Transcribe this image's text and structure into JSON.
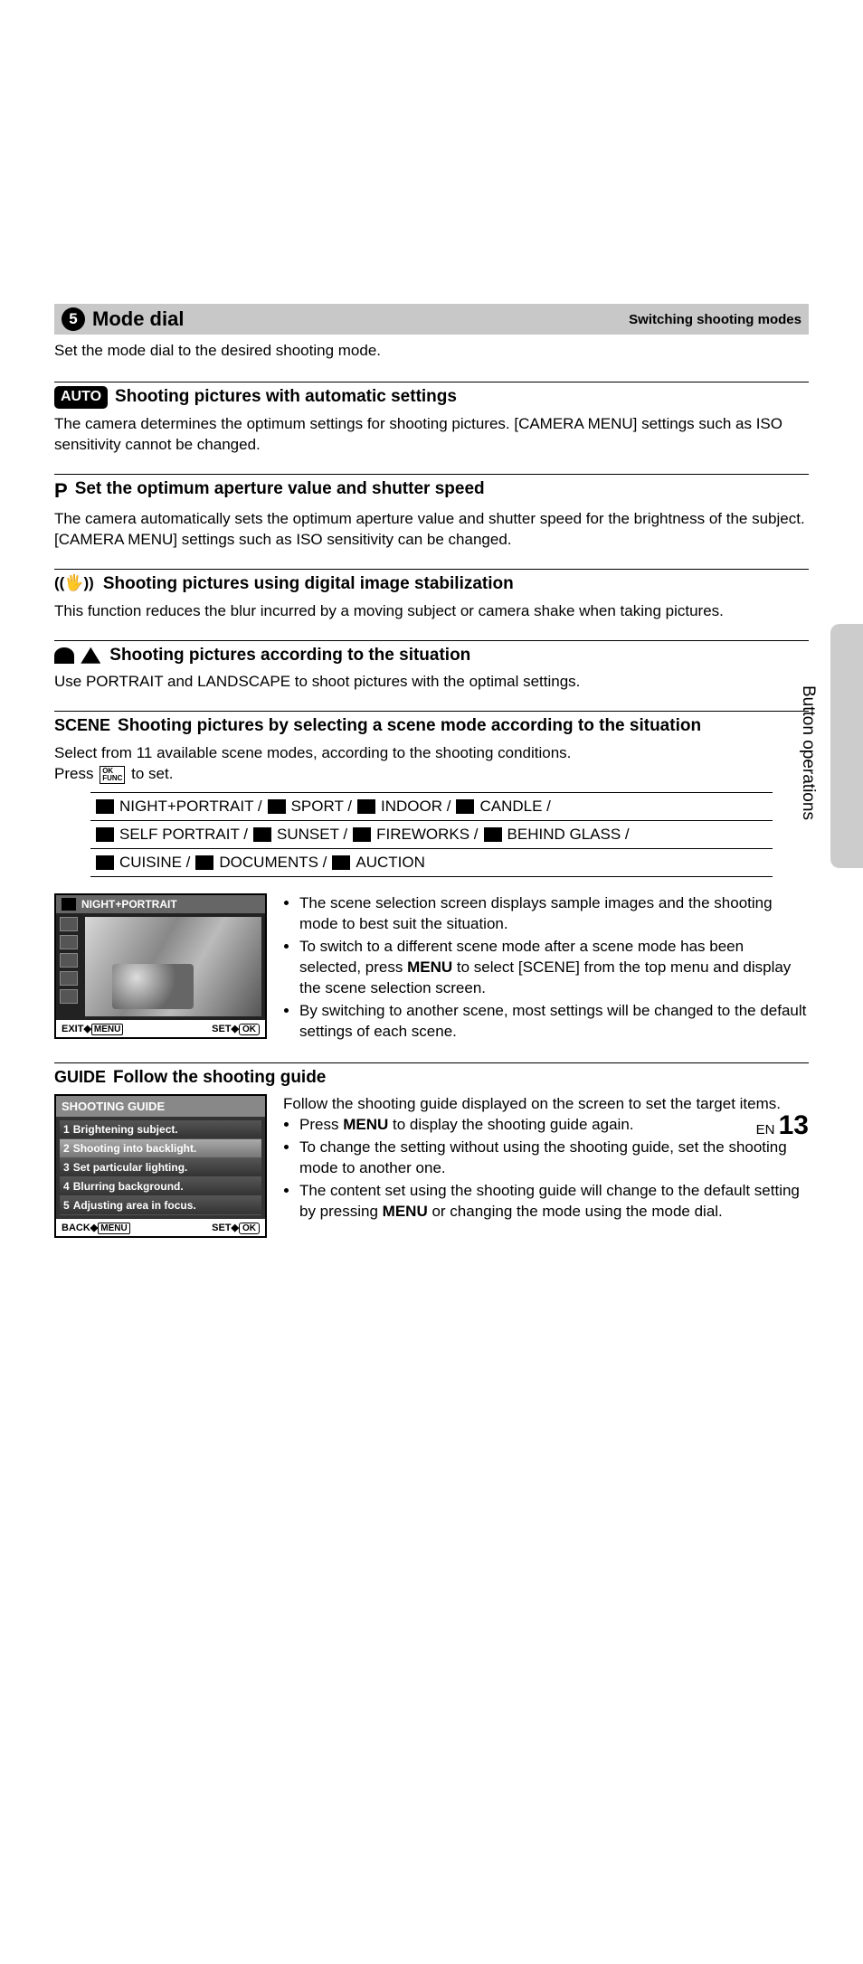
{
  "header": {
    "number": "5",
    "title": "Mode dial",
    "subtitle": "Switching shooting modes"
  },
  "intro": "Set the mode dial to the desired shooting mode.",
  "sections": {
    "auto": {
      "badge": "AUTO",
      "heading": "Shooting pictures with automatic settings",
      "body": "The camera determines the optimum settings for shooting pictures. [CAMERA MENU] settings such as ISO sensitivity cannot be changed."
    },
    "p": {
      "badge": "P",
      "heading": "Set the optimum aperture value and shutter speed",
      "body": "The camera automatically sets the optimum aperture value and shutter speed for the brightness of the subject. [CAMERA MENU] settings such as ISO sensitivity can be changed."
    },
    "stab": {
      "heading": "Shooting pictures using digital image stabilization",
      "body": "This function reduces the blur incurred by a moving subject or camera shake when taking pictures."
    },
    "pl": {
      "heading": "Shooting pictures according to the situation",
      "body": "Use PORTRAIT and LANDSCAPE to shoot pictures with the optimal settings."
    },
    "scene": {
      "badge": "SCENE",
      "heading": "Shooting pictures by selecting a scene mode according to the situation",
      "body1": "Select from 11 available scene modes, according to the shooting conditions.",
      "body2_pre": "Press ",
      "body2_post": " to set.",
      "ok_top": "OK",
      "ok_bot": "FUNC",
      "row1": [
        "NIGHT+PORTRAIT /",
        "SPORT /",
        "INDOOR /",
        "CANDLE /"
      ],
      "row2": [
        "SELF PORTRAIT /",
        "SUNSET /",
        "FIREWORKS /",
        "BEHIND GLASS /"
      ],
      "row3": [
        "CUISINE /",
        "DOCUMENTS /",
        "AUCTION"
      ],
      "lcd_title": "NIGHT+PORTRAIT",
      "lcd_exit": "EXIT",
      "lcd_set": "SET",
      "lcd_menu": "MENU",
      "lcd_ok": "OK",
      "bullets": [
        "The scene selection screen displays sample images and the shooting mode to best suit the situation.",
        "To switch to a different scene mode after a scene mode has been selected, press <b>MENU</b> to select [SCENE] from the top menu and display the scene selection screen.",
        "By switching to another scene, most settings will be changed to the default settings of each scene."
      ]
    },
    "guide": {
      "badge": "GUIDE",
      "heading": "Follow the shooting guide",
      "panel_title": "SHOOTING GUIDE",
      "items": [
        {
          "num": "1",
          "label": "Brightening subject."
        },
        {
          "num": "2",
          "label": "Shooting into backlight."
        },
        {
          "num": "3",
          "label": "Set particular lighting."
        },
        {
          "num": "4",
          "label": "Blurring background."
        },
        {
          "num": "5",
          "label": "Adjusting area in focus."
        }
      ],
      "back": "BACK",
      "set": "SET",
      "menu": "MENU",
      "ok": "OK",
      "body_intro": "Follow the shooting guide displayed on the screen to set the target items.",
      "bullets": [
        "Press <b>MENU</b> to display the shooting guide again.",
        "To change the setting without using the shooting guide, set the shooting mode to another one.",
        "The content set using the shooting guide will change to the default setting by pressing <b>MENU</b> or changing the mode using the mode dial."
      ]
    }
  },
  "side_label": "Button operations",
  "page_lang": "EN",
  "page_num": "13"
}
